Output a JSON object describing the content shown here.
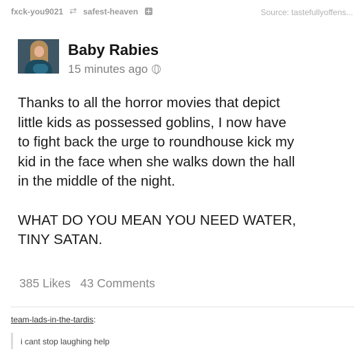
{
  "reblog_trail": {
    "user1": "fxck-you9021",
    "reblog_icon": "reblog-icon",
    "user2": "safest-heaven",
    "plus_icon": "plus-icon",
    "source": "Source: tastefullyoffens..."
  },
  "post": {
    "author": "Baby Rabies",
    "time": "15 minutes ago",
    "visibility_icon": "globe-icon",
    "paragraph1": "Thanks to all the horror movies that depict\nlittle kids as possessed goblins, I now have\nto fight back the urge to roundhouse kick my\nkid in the face when she walks down the hall\nin the middle of the night.",
    "paragraph2": "WHAT DO YOU MEAN YOU NEED WATER,\nTINY SATAN.",
    "likes": "385 Likes",
    "comments": "43 Comments"
  },
  "comment": {
    "user": "team-lads-in-the-tardis",
    "separator": ":",
    "text": "i cant stop laughing help"
  }
}
